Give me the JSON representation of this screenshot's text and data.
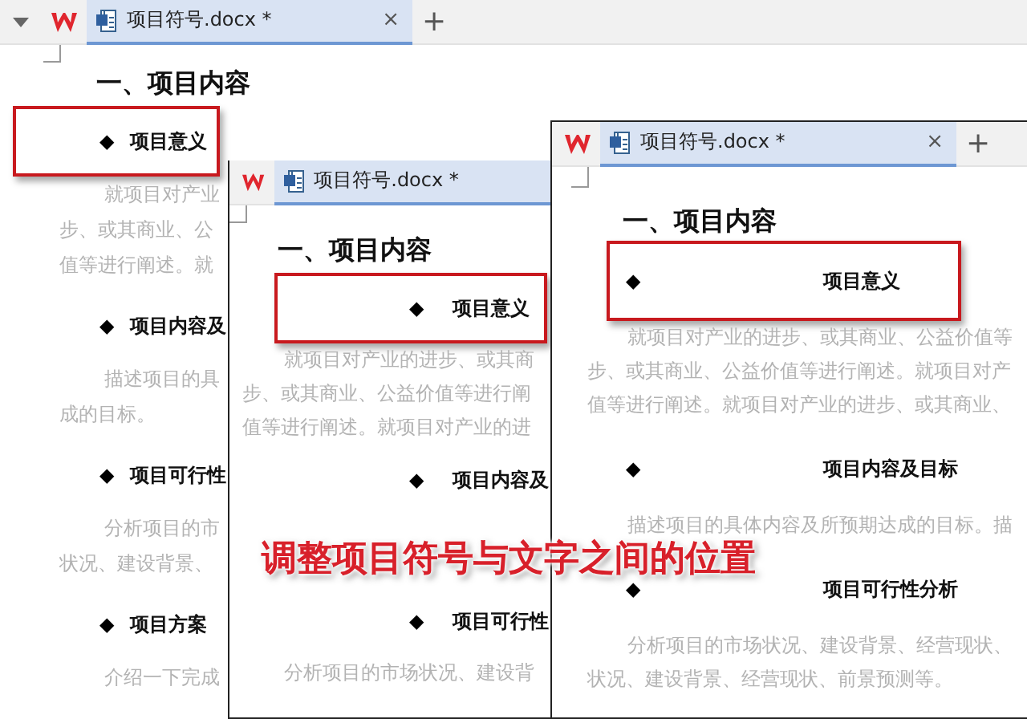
{
  "windows": [
    {
      "tab": {
        "title": "项目符号.docx *",
        "close": "×"
      },
      "new_tab": "+",
      "heading": "一、项目内容",
      "items": [
        {
          "bullet": "◆",
          "title": "项目意义",
          "highlighted": true,
          "lines": [
            "就项目对产业",
            "步、或其商业、公",
            "值等进行阐述。就"
          ]
        },
        {
          "bullet": "◆",
          "title": "项目内容及",
          "highlighted": false,
          "lines": [
            "描述项目的具",
            "成的目标。"
          ]
        },
        {
          "bullet": "◆",
          "title": "项目可行性",
          "highlighted": false,
          "lines": [
            "分析项目的市",
            "状况、建设背景、"
          ]
        },
        {
          "bullet": "◆",
          "title": "项目方案",
          "highlighted": false,
          "lines": [
            "介绍一下完成"
          ]
        }
      ]
    },
    {
      "tab": {
        "title": "项目符号.docx *"
      },
      "heading": "一、项目内容",
      "items": [
        {
          "bullet": "◆",
          "title": "项目意义",
          "highlighted": true,
          "lines": [
            "就项目对产业的进步、或其商",
            "步、或其商业、公益价值等进行阐",
            "值等进行阐述。就项目对产业的进"
          ]
        },
        {
          "bullet": "◆",
          "title": "项目内容及",
          "highlighted": false
        },
        {
          "bullet": "◆",
          "title": "项目可行性",
          "highlighted": false,
          "lines": [
            "分析项目的市场状况、建设背"
          ]
        }
      ]
    },
    {
      "tab": {
        "title": "项目符号.docx *",
        "close": "×"
      },
      "new_tab": "+",
      "heading": "一、项目内容",
      "items": [
        {
          "bullet": "◆",
          "title": "项目意义",
          "highlighted": true,
          "lines": [
            "就项目对产业的进步、或其商业、公益价值等",
            "步、或其商业、公益价值等进行阐述。就项目对产",
            "值等进行阐述。就项目对产业的进步、或其商业、"
          ]
        },
        {
          "bullet": "◆",
          "title": "项目内容及目标",
          "highlighted": false,
          "lines": [
            "描述项目的具体内容及所预期达成的目标。描"
          ]
        },
        {
          "bullet": "◆",
          "title": "项目可行性分析",
          "highlighted": false,
          "lines": [
            "分析项目的市场状况、建设背景、经营现状、",
            "状况、建设背景、经营现状、前景预测等。"
          ]
        }
      ]
    }
  ],
  "caption": "调整项目符号与文字之间的位置"
}
